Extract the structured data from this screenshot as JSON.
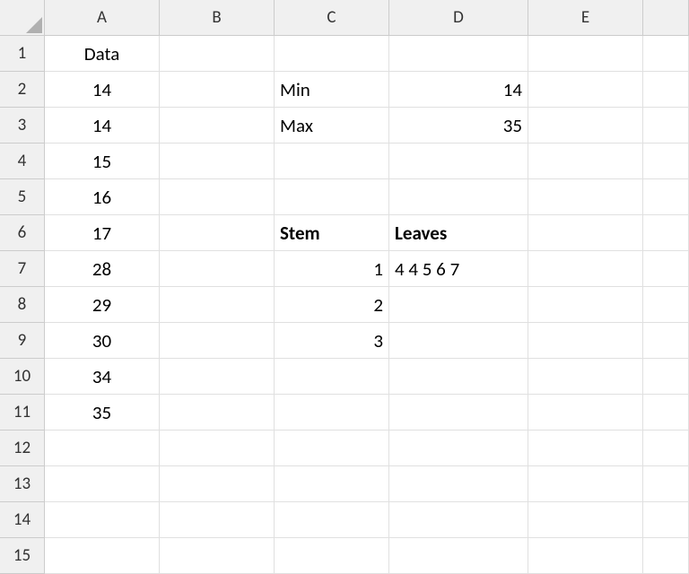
{
  "columns": [
    "A",
    "B",
    "C",
    "D",
    "E"
  ],
  "rows": [
    "1",
    "2",
    "3",
    "4",
    "5",
    "6",
    "7",
    "8",
    "9",
    "10",
    "11",
    "12",
    "13",
    "14",
    "15"
  ],
  "cells": {
    "A1": "Data",
    "A2": "14",
    "A3": "14",
    "A4": "15",
    "A5": "16",
    "A6": "17",
    "A7": "28",
    "A8": "29",
    "A9": "30",
    "A10": "34",
    "A11": "35",
    "C2": "Min",
    "D2": "14",
    "C3": "Max",
    "D3": "35",
    "C6": "Stem",
    "D6": "Leaves",
    "C7": "1",
    "D7": "4  4  5  6  7",
    "C8": "2",
    "C9": "3"
  }
}
